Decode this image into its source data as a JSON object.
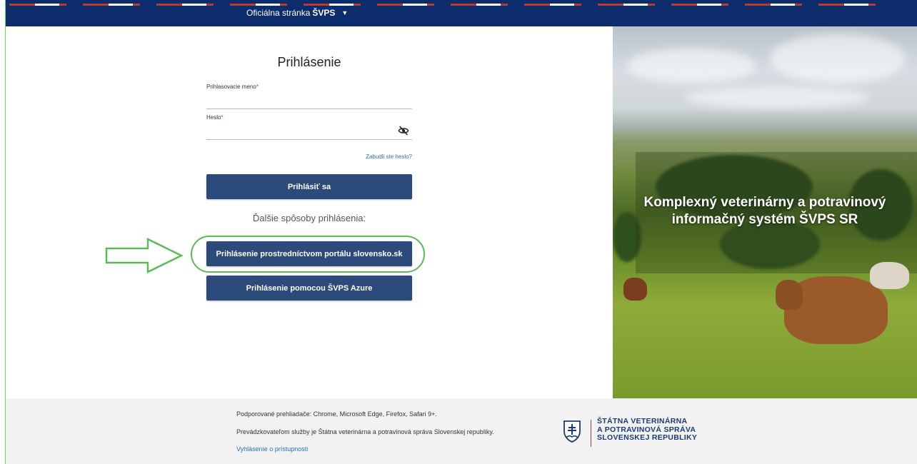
{
  "header": {
    "official_text": "Oficiálna stránka",
    "official_brand": "ŠVPS",
    "caret": "▼"
  },
  "login": {
    "title": "Prihlásenie",
    "username_label": "Prihlasovacie meno",
    "password_label": "Heslo",
    "required_mark": "*",
    "username_value": "",
    "password_value": "",
    "forgot_link": "Zabudli ste heslo?",
    "submit_label": "Prihlásiť sa",
    "other_methods_text": "Ďalšie spôsoby prihlásenia:",
    "slovensko_button": "Prihlásenie prostredníctvom portálu slovensko.sk",
    "azure_button": "Prihlásenie pomocou ŠVPS Azure"
  },
  "hero": {
    "line1": "Komplexný veterinárny a potravinový",
    "line2": "informačný systém ŠVPS SR"
  },
  "footer": {
    "browsers": "Podporované prehliadače: Chrome, Microsoft Edge, Firefox, Safari 9+.",
    "operator": "Prevádzkovateľom služby je Štátna veterinárna a potravinová správa Slovenskej republiky.",
    "accessibility": "Vyhlásenie o prístupnosti",
    "logo_line1": "ŠTÁTNA VETERINÁRNA",
    "logo_line2": "A POTRAVINOVÁ SPRÁVA",
    "logo_line3": "SLOVENSKEJ REPUBLIKY"
  },
  "colors": {
    "header_bg": "#0d2c6b",
    "button_bg": "#2c4a7a",
    "link": "#2a6fb5",
    "annotation": "#5cba55",
    "required": "#d32f2f"
  },
  "icons": {
    "password_toggle": "eye-off-icon",
    "annotation_arrow": "arrow-right-icon",
    "crest": "slovak-crest-icon"
  }
}
